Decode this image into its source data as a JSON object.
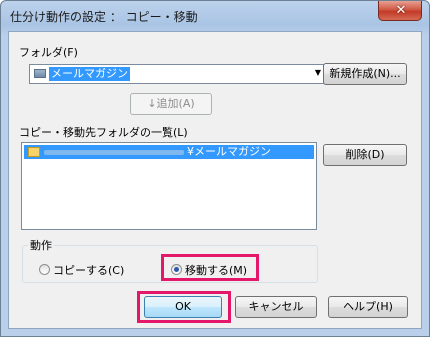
{
  "window": {
    "title": "仕分け動作の設定 ： コピー・移動"
  },
  "icons": {
    "close": "close-icon",
    "folder": "folder-icon",
    "dropdown": "chevron-down-icon"
  },
  "folder": {
    "label": "フォルダ(F)",
    "selected": "メールマガジン",
    "new_button": "新規作成(N)...",
    "add_button": "↓追加(A)"
  },
  "dest_list": {
    "label": "コピー・移動先フォルダの一覧(L)",
    "items": [
      {
        "path_suffix": "¥メールマガジン"
      }
    ],
    "delete_button": "削除(D)"
  },
  "action": {
    "label": "動作",
    "options": [
      {
        "label": "コピーする(C)",
        "selected": false
      },
      {
        "label": "移動する(M)",
        "selected": true
      }
    ]
  },
  "footer": {
    "ok": "OK",
    "cancel": "キャンセル",
    "help": "ヘルプ(H)"
  },
  "colors": {
    "selection": "#3399ff",
    "highlight_box": "#e3186a",
    "titlebar": "#a9c4e4",
    "close_button": "#c23a26"
  }
}
